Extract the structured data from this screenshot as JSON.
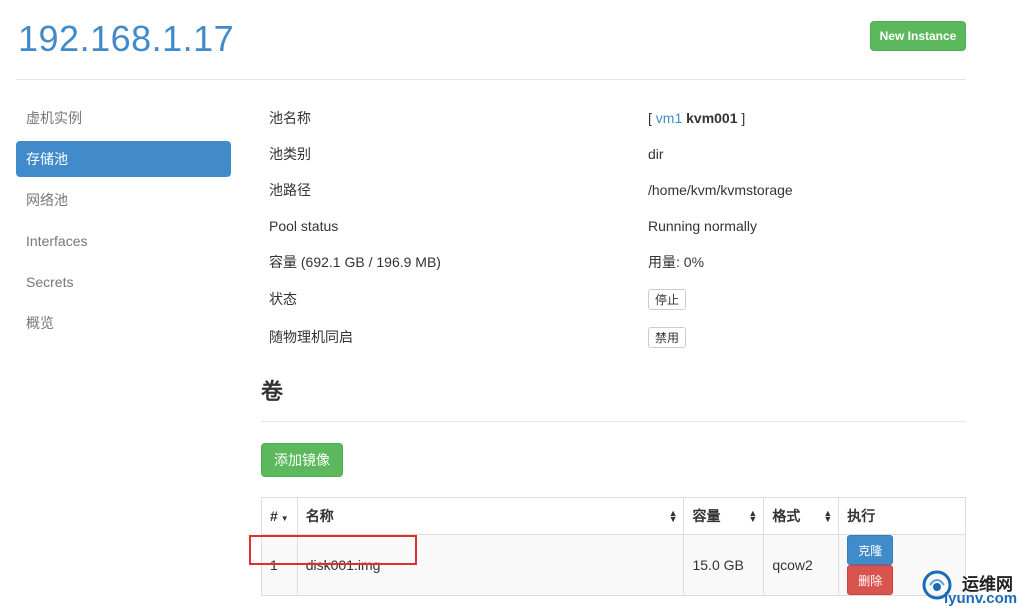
{
  "header": {
    "host": "192.168.1.17",
    "new_instance_label": "New Instance"
  },
  "sidebar": {
    "items": [
      {
        "label": "虚机实例",
        "active": false
      },
      {
        "label": "存储池",
        "active": true
      },
      {
        "label": "网络池",
        "active": false
      },
      {
        "label": "Interfaces",
        "active": false
      },
      {
        "label": "Secrets",
        "active": false
      },
      {
        "label": "概览",
        "active": false
      }
    ]
  },
  "pool": {
    "name_label": "池名称",
    "name_open": "[",
    "name_link": "vm1",
    "name_bold": "kvm001",
    "name_close": "]",
    "type_label": "池类别",
    "type_value": "dir",
    "path_label": "池路径",
    "path_value": "/home/kvm/kvmstorage",
    "status_label": "Pool status",
    "status_value": "Running normally",
    "capacity_label": "容量 (692.1 GB / 196.9 MB)",
    "usage_value": "用量: 0%",
    "state_label": "状态",
    "state_button": "停止",
    "autostart_label": "随物理机同启",
    "autostart_button": "禁用"
  },
  "volumes": {
    "title": "卷",
    "add_button": "添加镜像",
    "columns": [
      "#",
      "名称",
      "容量",
      "格式",
      "执行"
    ],
    "rows": [
      {
        "index": "1",
        "name": "disk001.img",
        "size": "15.0 GB",
        "format": "qcow2",
        "clone": "克隆",
        "delete": "删除"
      }
    ]
  },
  "watermark": {
    "cn": "运维网",
    "en": "iyunv.com"
  },
  "colors": {
    "primary": "#428bca",
    "success": "#5cb85c",
    "danger": "#d9534f",
    "highlight": "#e0302b"
  }
}
